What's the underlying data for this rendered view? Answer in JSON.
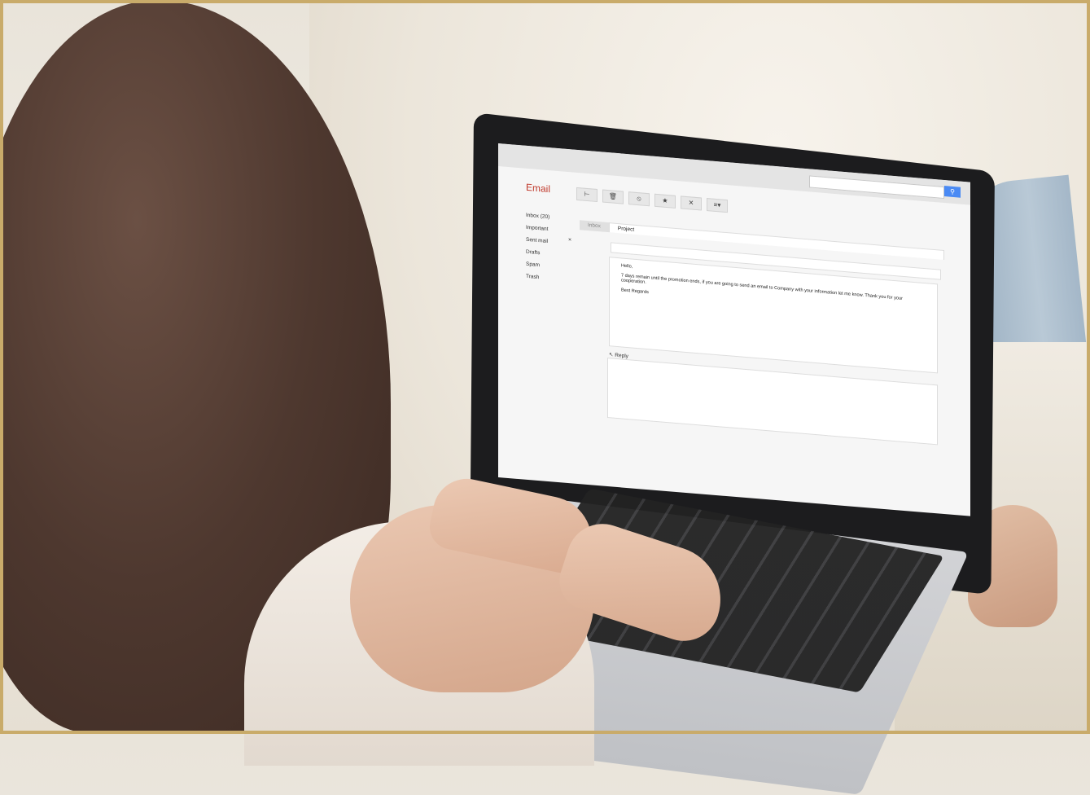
{
  "app": {
    "brand": "Email"
  },
  "search": {
    "placeholder": "",
    "button_icon": "search-icon"
  },
  "toolbar": {
    "icons": [
      "flag-icon",
      "trash-icon",
      "block-icon",
      "star-icon",
      "close-icon",
      "menu-icon"
    ],
    "glyphs": [
      "⊢",
      "🗑",
      "⦸",
      "★",
      "✕",
      "≡▾"
    ]
  },
  "sidebar": {
    "items": [
      {
        "label": "Inbox (20)"
      },
      {
        "label": "Important"
      },
      {
        "label": "Sent mail"
      },
      {
        "label": "Drafts"
      },
      {
        "label": "Spam"
      },
      {
        "label": "Trash"
      }
    ],
    "close_glyph": "×"
  },
  "tabs": [
    {
      "label": "Inbox"
    },
    {
      "label": "Project"
    }
  ],
  "message": {
    "greeting": "Hello,",
    "body": "7 days remain until the promotion ends, if you are going to send an email to Company with your information let me know. Thank you for your cooperation.",
    "signoff": "Best Regards"
  },
  "reply": {
    "label": "Reply",
    "icon": "reply-icon"
  },
  "colors": {
    "brand": "#c0392b",
    "search_button": "#4a8af4",
    "frame": "#c9ab6a"
  }
}
